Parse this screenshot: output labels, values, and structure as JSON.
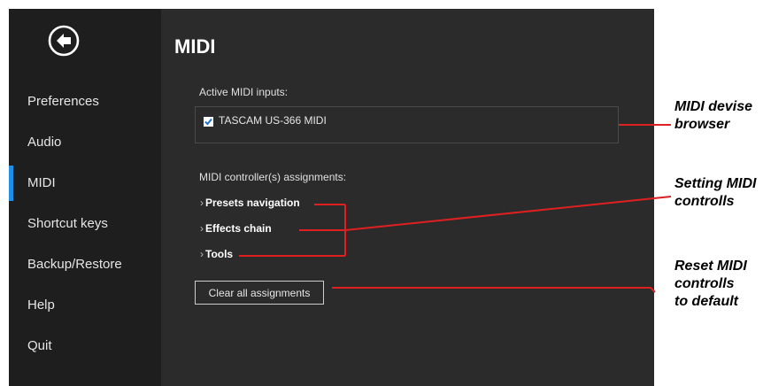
{
  "sidebar": {
    "items": [
      {
        "label": "Preferences",
        "active": false
      },
      {
        "label": "Audio",
        "active": false
      },
      {
        "label": "MIDI",
        "active": true
      },
      {
        "label": "Shortcut keys",
        "active": false
      },
      {
        "label": "Backup/Restore",
        "active": false
      },
      {
        "label": "Help",
        "active": false
      },
      {
        "label": "Quit",
        "active": false
      }
    ]
  },
  "main": {
    "title": "MIDI",
    "inputs_label": "Active MIDI inputs:",
    "device": {
      "name": "TASCAM US-366 MIDI",
      "checked": true
    },
    "assign_label": "MIDI controller(s) assignments:",
    "assignments": [
      {
        "label": "Presets navigation"
      },
      {
        "label": "Effects chain"
      },
      {
        "label": "Tools"
      }
    ],
    "clear_button": "Clear all assignments"
  },
  "annotations": {
    "browser": [
      "MIDI  devise",
      "browser"
    ],
    "setting": [
      "Setting MIDI",
      "controlls"
    ],
    "reset": [
      "Reset MIDI",
      "controlls",
      "to default"
    ]
  },
  "colors": {
    "accent": "#1e8fe8",
    "annotation_line": "#e02020"
  }
}
